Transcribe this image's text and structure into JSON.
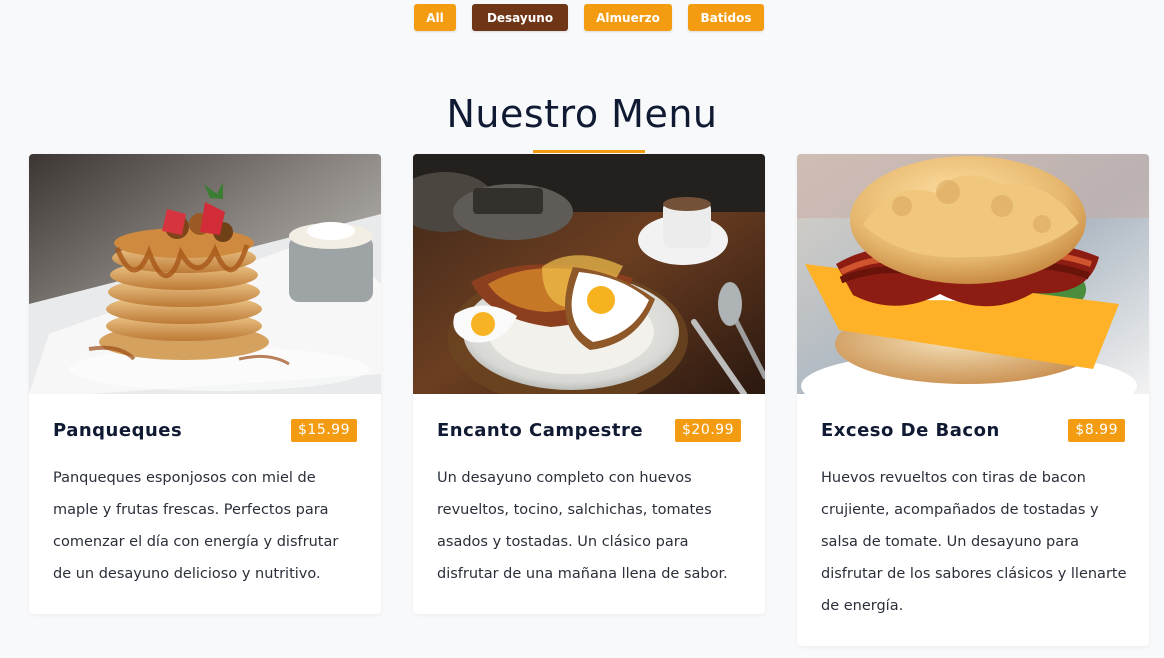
{
  "filters": {
    "all": "All",
    "breakfast": "Desayuno",
    "lunch": "Almuerzo",
    "shakes": "Batidos",
    "active": "Desayuno"
  },
  "section": {
    "title": "Nuestro Menu"
  },
  "colors": {
    "accent": "#f39c12",
    "active_filter": "#6e3517",
    "title": "#101a33",
    "background": "#f8f9fb"
  },
  "items": [
    {
      "name": "Panqueques",
      "price": "$15.99",
      "description": "Panqueques esponjosos con miel de maple y frutas frescas. Perfectos para comenzar el día con energía y disfrutar de un desayuno delicioso y nutritivo.",
      "image": "pancakes-photo"
    },
    {
      "name": "Encanto Campestre",
      "price": "$20.99",
      "description": "Un desayuno completo con huevos revueltos, tocino, salchichas, tomates asados y tostadas. Un clásico para disfrutar de una mañana llena de sabor.",
      "image": "breakfast-plate-photo"
    },
    {
      "name": "Exceso De Bacon",
      "price": "$8.99",
      "description": "Huevos revueltos con tiras de bacon crujiente, acompañados de tostadas y salsa de tomate. Un desayuno para disfrutar de los sabores clásicos y llenarte de energía.",
      "image": "bacon-sandwich-photo"
    }
  ]
}
